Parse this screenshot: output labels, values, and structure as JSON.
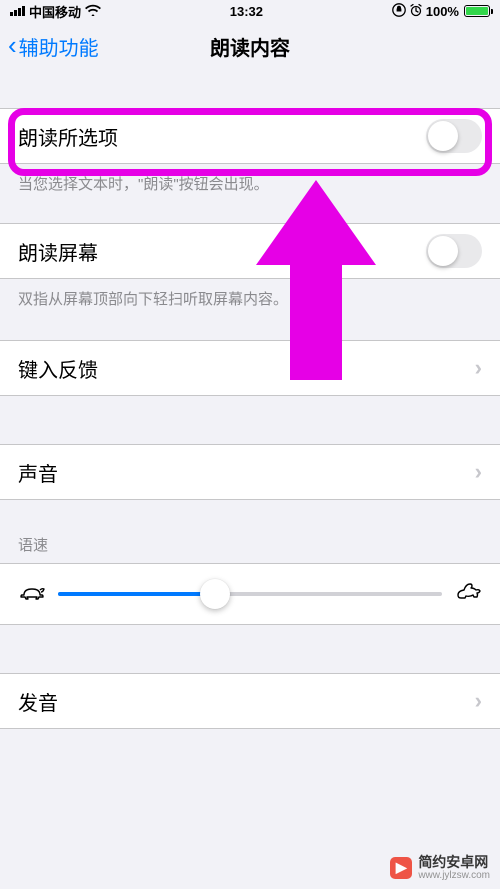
{
  "status": {
    "carrier": "中国移动",
    "time": "13:32",
    "battery_pct": "100%"
  },
  "nav": {
    "back_label": "辅助功能",
    "title": "朗读内容"
  },
  "rows": {
    "speak_selection": {
      "label": "朗读所选项",
      "on": false
    },
    "speak_selection_footer": "当您选择文本时，\"朗读\"按钮会出现。",
    "speak_screen": {
      "label": "朗读屏幕",
      "on": false
    },
    "speak_screen_footer": "双指从屏幕顶部向下轻扫听取屏幕内容。",
    "typing_feedback": {
      "label": "键入反馈"
    },
    "voices": {
      "label": "声音"
    },
    "rate_header": "语速",
    "rate_value_pct": 41,
    "pronunciations": {
      "label": "发音"
    }
  },
  "watermark": {
    "title": "简约安卓网",
    "url": "www.jylzsw.com"
  }
}
